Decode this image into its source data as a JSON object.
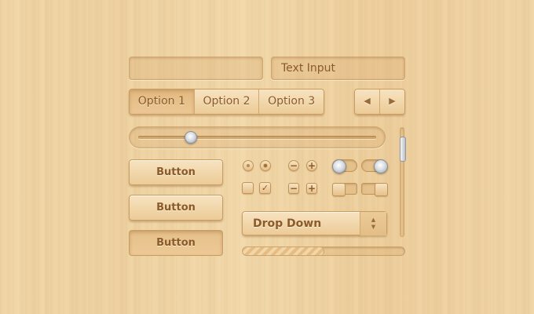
{
  "inputs": {
    "empty_value": "",
    "text_input_value": "Text Input"
  },
  "segmented": {
    "options": [
      "Option 1",
      "Option 2",
      "Option 3"
    ],
    "selected_index": 0
  },
  "pager": {
    "prev_icon": "left-triangle-icon",
    "next_icon": "right-triangle-icon"
  },
  "slider": {
    "value": 0.22
  },
  "buttons": {
    "labels": [
      "Button",
      "Button",
      "Button"
    ]
  },
  "controls": {
    "radio_selected_index": 1,
    "checkbox_checked_index": 1,
    "checkbox_mark": "✓",
    "minus": "−",
    "plus": "+"
  },
  "dropdown": {
    "label": "Drop Down",
    "arrows_icon": "up-down-arrows-icon"
  },
  "progress": {
    "value": 0.5
  },
  "scrollbar": {
    "position": 0.1
  },
  "colors": {
    "wood": "#f1d6a7",
    "text": "#8b5a2a",
    "accent_metal": "#c8ced5"
  }
}
